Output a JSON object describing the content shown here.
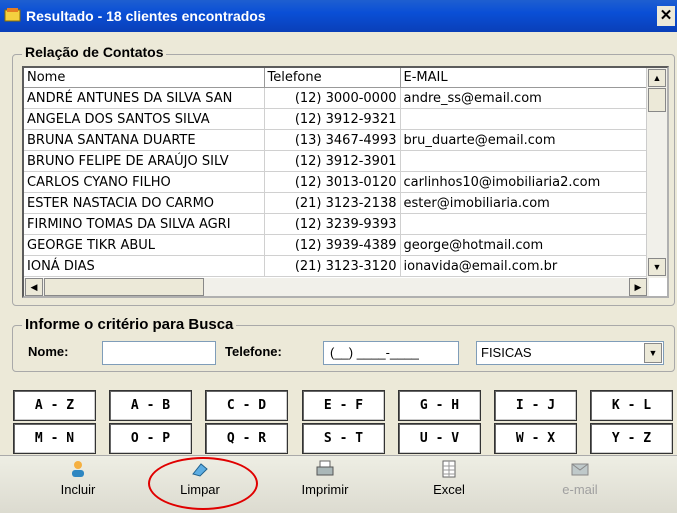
{
  "window": {
    "title": "Resultado - 18 clientes encontrados",
    "close_glyph": "✕"
  },
  "contacts": {
    "legend": "Relação de Contatos",
    "columns": [
      "Nome",
      "Telefone",
      "E-MAIL"
    ],
    "rows": [
      {
        "nome": "ANDRÉ ANTUNES DA SILVA SAN",
        "telefone": "(12) 3000-0000",
        "email": "andre_ss@email.com"
      },
      {
        "nome": "ANGELA DOS SANTOS SILVA",
        "telefone": "(12) 3912-9321",
        "email": ""
      },
      {
        "nome": "BRUNA SANTANA DUARTE",
        "telefone": "(13) 3467-4993",
        "email": "bru_duarte@email.com"
      },
      {
        "nome": "BRUNO FELIPE DE ARAÚJO SILV",
        "telefone": "(12) 3912-3901",
        "email": ""
      },
      {
        "nome": "CARLOS CYANO FILHO",
        "telefone": "(12) 3013-0120",
        "email": "carlinhos10@imobiliaria2.com"
      },
      {
        "nome": "ESTER NASTACIA DO CARMO",
        "telefone": "(21) 3123-2138",
        "email": "ester@imobiliaria.com"
      },
      {
        "nome": "FIRMINO TOMAS DA SILVA AGRI",
        "telefone": "(12) 3239-9393",
        "email": ""
      },
      {
        "nome": "GEORGE TIKR ABUL",
        "telefone": "(12) 3939-4389",
        "email": "george@hotmail.com"
      },
      {
        "nome": "IONÁ DIAS",
        "telefone": "(21) 3123-3120",
        "email": "ionavida@email.com.br"
      }
    ]
  },
  "search": {
    "legend": "Informe o critério para Busca",
    "nome_label": "Nome:",
    "nome_value": "",
    "telefone_label": "Telefone:",
    "telefone_value": "(__) ____-____",
    "tipo_selected": "FISICAS"
  },
  "alphabet": {
    "row1": [
      "A - Z",
      "A - B",
      "C - D",
      "E - F",
      "G - H",
      "I - J",
      "K - L"
    ],
    "row2": [
      "M - N",
      "O - P",
      "Q - R",
      "S - T",
      "U - V",
      "W - X",
      "Y - Z"
    ]
  },
  "toolbar": {
    "incluir": "Incluir",
    "limpar": "Limpar",
    "imprimir": "Imprimir",
    "excel": "Excel",
    "email": "e-mail"
  },
  "colors": {
    "title_bar": "#0A4FD6",
    "highlight_circle": "#E00000",
    "dialog_bg": "#ECE9D8"
  },
  "icons": {
    "app": "contacts-book-icon",
    "incluir": "user-add-icon",
    "limpar": "eraser-icon",
    "imprimir": "printer-icon",
    "excel": "spreadsheet-icon",
    "email": "mail-icon"
  }
}
